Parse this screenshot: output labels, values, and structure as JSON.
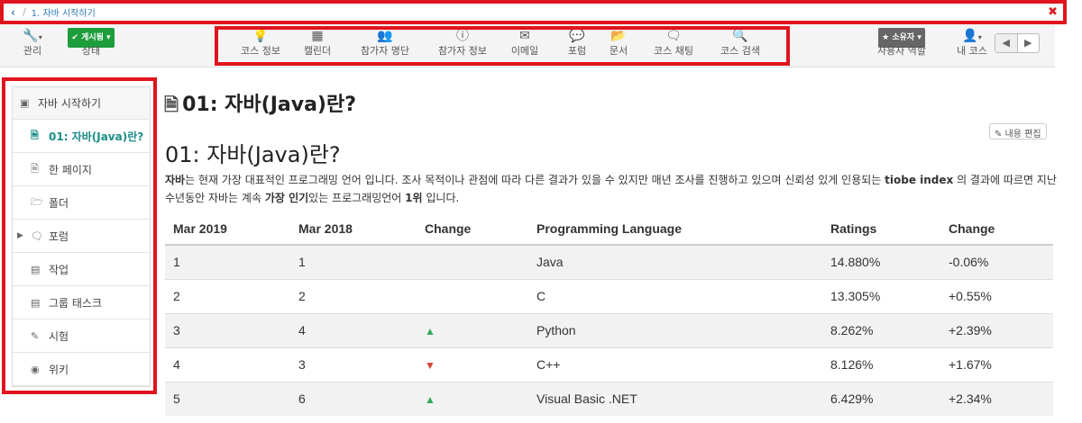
{
  "breadcrumb": {
    "back": "‹",
    "separator": "/",
    "current": "1. 자바 시작하기",
    "close": "✖"
  },
  "toolbar": {
    "manage": {
      "icon": "wrench-icon",
      "label": "관리"
    },
    "status": {
      "badge": "✔ 게시됨 ▾",
      "label": "상태"
    },
    "center": [
      {
        "icon": "lightbulb-icon",
        "glyph": "💡",
        "label": "코스 정보"
      },
      {
        "icon": "calendar-icon",
        "glyph": "▦",
        "label": "캘린더"
      },
      {
        "icon": "users-icon",
        "glyph": "👥",
        "label": "참가자 명단"
      },
      {
        "icon": "info-icon",
        "glyph": "ⓘ",
        "label": "참가자 정보"
      },
      {
        "icon": "envelope-icon",
        "glyph": "✉",
        "label": "이메일"
      },
      {
        "icon": "comments-icon",
        "glyph": "💬",
        "label": "포럼"
      },
      {
        "icon": "folder-icon",
        "glyph": "📂",
        "label": "문서"
      },
      {
        "icon": "chat-icon",
        "glyph": "🗨",
        "label": "코스 채팅"
      },
      {
        "icon": "search-icon",
        "glyph": "🔍",
        "label": "코스 검색"
      }
    ],
    "role": {
      "badge": "★ 소유자 ▾",
      "label": "사용자 역할"
    },
    "mycourse": {
      "icon": "user-icon",
      "label": "내 코스"
    },
    "prev": "◀",
    "next": "▶"
  },
  "sidebar": {
    "title": "자바 시작하기",
    "items": [
      {
        "icon": "page-icon",
        "glyph": "🗎",
        "label": "01: 자바(Java)란?",
        "active": true
      },
      {
        "icon": "page-icon",
        "glyph": "🗎",
        "label": "한 페이지"
      },
      {
        "icon": "folder-icon",
        "glyph": "🗁",
        "label": "폴더"
      },
      {
        "icon": "comments-icon",
        "glyph": "🗨",
        "label": "포럼"
      },
      {
        "icon": "task-icon",
        "glyph": "▤",
        "label": "작업"
      },
      {
        "icon": "group-task-icon",
        "glyph": "▤",
        "label": "그룹 태스크"
      },
      {
        "icon": "test-icon",
        "glyph": "✎",
        "label": "시험"
      },
      {
        "icon": "wiki-icon",
        "glyph": "◉",
        "label": "위키"
      }
    ]
  },
  "main": {
    "page_title": "01: 자바(Java)란?",
    "edit_label": "✎ 내용 편집",
    "heading": "01: 자바(Java)란?",
    "para_parts": [
      "자바",
      "는 현재 가장 대표적인 프로그래밍 언어 입니다. 조사 목적이나 관점에 따라 다른 결과가 있을 수 있지만 매년 조사를 진행하고 있으며 신뢰성 있게 인용되는 ",
      "tiobe index",
      " 의 결과에 따르면 지난 수년동안 자바는 계속 ",
      "가장 인기",
      "있는 프로그래밍언어 ",
      "1위",
      " 입니다."
    ]
  },
  "table": {
    "headers": [
      "Mar 2019",
      "Mar 2018",
      "Change",
      "Programming Language",
      "Ratings",
      "Change"
    ],
    "rows": [
      [
        "1",
        "1",
        "",
        "Java",
        "14.880%",
        "-0.06%"
      ],
      [
        "2",
        "2",
        "",
        "C",
        "13.305%",
        "+0.55%"
      ],
      [
        "3",
        "4",
        "up",
        "Python",
        "8.262%",
        "+2.39%"
      ],
      [
        "4",
        "3",
        "down",
        "C++",
        "8.126%",
        "+1.67%"
      ],
      [
        "5",
        "6",
        "up",
        "Visual Basic .NET",
        "6.429%",
        "+2.34%"
      ]
    ]
  }
}
